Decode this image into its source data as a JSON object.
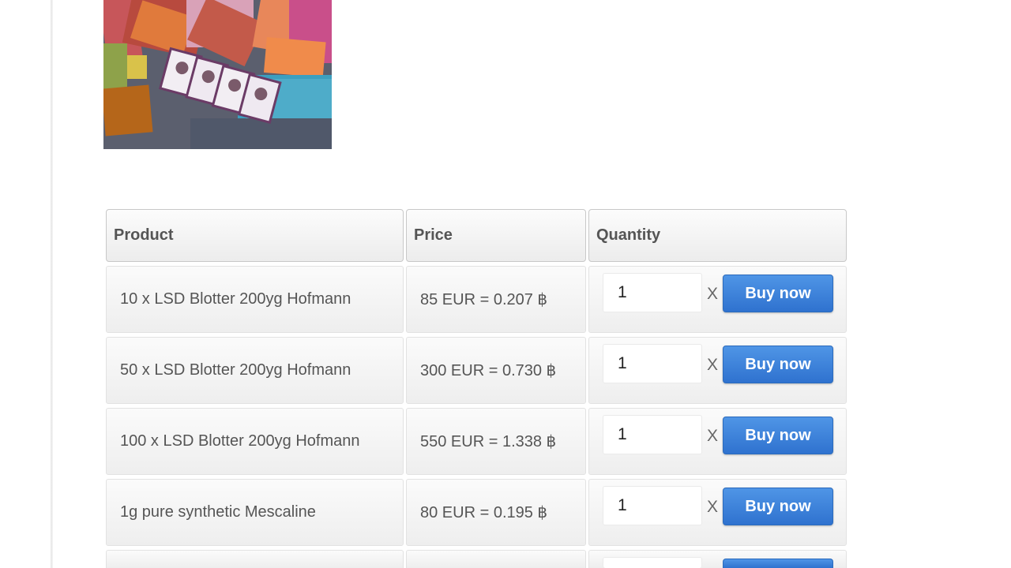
{
  "product_image": {
    "alt": ""
  },
  "table": {
    "headers": {
      "product": "Product",
      "price": "Price",
      "quantity": "Quantity"
    },
    "rows": [
      {
        "product": "10 x LSD Blotter 200yg Hofmann",
        "price": "85 EUR = 0.207 ฿",
        "quantity": "1",
        "times": "X",
        "buy_label": "Buy now"
      },
      {
        "product": "50 x LSD Blotter 200yg Hofmann",
        "price": "300 EUR = 0.730 ฿",
        "quantity": "1",
        "times": "X",
        "buy_label": "Buy now"
      },
      {
        "product": "100 x LSD Blotter 200yg Hofmann",
        "price": "550 EUR = 1.338 ฿",
        "quantity": "1",
        "times": "X",
        "buy_label": "Buy now"
      },
      {
        "product": "1g pure synthetic Mescaline",
        "price": "80 EUR = 0.195 ฿",
        "quantity": "1",
        "times": "X",
        "buy_label": "Buy now"
      },
      {
        "product": "",
        "price": "",
        "quantity": "",
        "times": "",
        "buy_label": ""
      }
    ]
  },
  "colors": {
    "button": "#3a80d9",
    "header_border": "#c8c8c8",
    "text": "#555555"
  }
}
